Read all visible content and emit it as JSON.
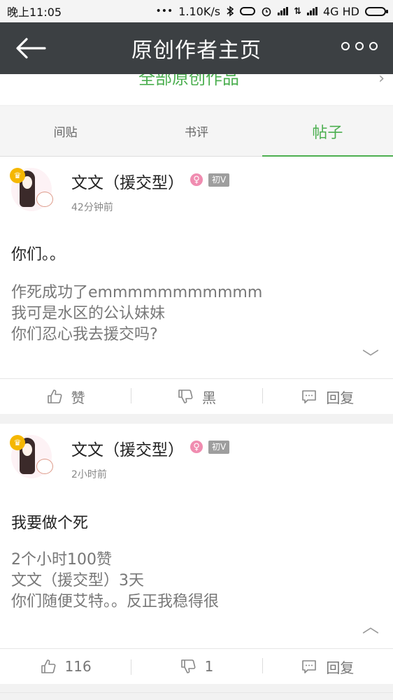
{
  "status_bar": {
    "time": "晚上11:05",
    "dots": "•••",
    "speed": "1.10K/s",
    "bluetooth_icon": "bluetooth-icon",
    "alarm_icon": "alarm-icon",
    "network": "4G HD"
  },
  "header": {
    "title": "原创作者主页",
    "back_icon": "back-arrow-icon",
    "more_icon": "more-options-icon"
  },
  "top_row": {
    "label": "全部原创作品",
    "chevron": "›"
  },
  "tabs": [
    {
      "label": "间贴",
      "active": false
    },
    {
      "label": "书评",
      "active": false
    },
    {
      "label": "帖子",
      "active": true
    }
  ],
  "posts": [
    {
      "author": "文文（援交型）",
      "gender": "♀",
      "level": "初V",
      "crown": "♛",
      "time": "42分钟前",
      "title": "你们。。",
      "body": "作死成功了emmmmmmmmmmm\n我可是水区的公认妹妹\n你们忍心我去援交吗?",
      "toggle": "﹀",
      "like_label": "赞",
      "dislike_label": "黑",
      "reply_label": "回复"
    },
    {
      "author": "文文（援交型）",
      "gender": "♀",
      "level": "初V",
      "crown": "♛",
      "time": "2小时前",
      "title": "我要做个死",
      "body": "2个小时100赞\n文文（援交型）3天\n你们随便艾特。。反正我稳得很",
      "toggle": "︿",
      "like_label": "116",
      "dislike_label": "1",
      "reply_label": "回复"
    }
  ]
}
